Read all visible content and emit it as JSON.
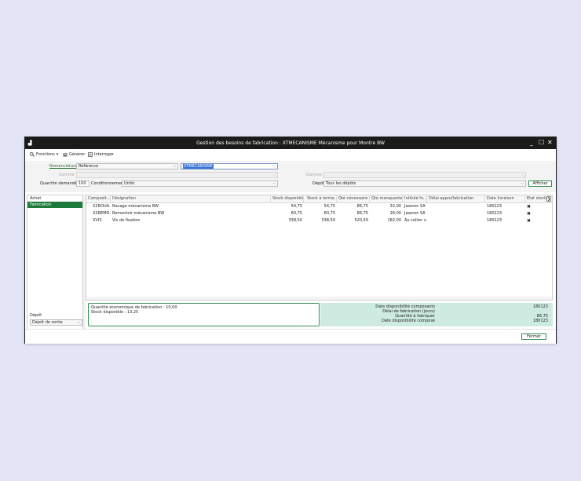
{
  "window": {
    "title": "Gestion des besoins de fabrication : XTMECANISME Mécanisme pour Montre BW",
    "minimize": "_",
    "maximize": "☐",
    "close": "✕"
  },
  "toolbar": {
    "fonctions": "Fonctions",
    "generer": "Générer",
    "interroger": "Interroger"
  },
  "form": {
    "nomenclature_label": "Nomenclature",
    "nomenclature_value": "Référence",
    "reference_value": "XTMECANISME",
    "gamme1_label": "Gamme 1",
    "gamme2_label": "Gamme 2",
    "quantite_label": "Quantité demandée",
    "quantite_value": "100",
    "conditionnement_label": "Conditionnement",
    "conditionnement_value": "Unité",
    "depot_label": "Dépôt",
    "depot_value": "Tous les dépôts",
    "afficher": "Afficher"
  },
  "sidebar": {
    "items": [
      {
        "label": "Achat"
      },
      {
        "label": "Fabrication"
      }
    ],
    "depot_label": "Dépôt",
    "depot_value": "Dépôt de sortie"
  },
  "table": {
    "columns": [
      "Composit...",
      "Désignation",
      "Stock disponible",
      "Stock à terme",
      "Qté nécessaire",
      "Qté manquante",
      "Intitulé fo...",
      "Délai appro/fabrication",
      "Date livraison",
      "Etat stock"
    ],
    "rows": [
      {
        "composant": "X2ROUA...",
        "designation": "Rouage mécanisme BW",
        "stock_dispo": "54,75",
        "stock_terme": "54,75",
        "qte_nec": "86,75",
        "qte_manq": "32,00",
        "fournisseur": "Jaseron SA",
        "delai": "",
        "date_liv": "180123",
        "etat": "✖"
      },
      {
        "composant": "X2REMO...",
        "designation": "Remontoir mécanisme BW",
        "stock_dispo": "60,75",
        "stock_terme": "60,75",
        "qte_nec": "86,75",
        "qte_manq": "26,00",
        "fournisseur": "Jaseron SA",
        "delai": "",
        "date_liv": "180123",
        "etat": "✖"
      },
      {
        "composant": "XVIS",
        "designation": "Vis de fixation",
        "stock_dispo": "338,50",
        "stock_terme": "338,50",
        "qte_nec": "520,50",
        "qte_manq": "182,00",
        "fournisseur": "Au collier s...",
        "delai": "",
        "date_liv": "180123",
        "etat": "✖"
      }
    ]
  },
  "info": {
    "line1": "Quantité économique de fabrication : 10,00",
    "line2": "Stock disponible : 13,25"
  },
  "summary": {
    "rows": [
      {
        "label": "Date disponibilité composants",
        "value": "180123"
      },
      {
        "label": "Délai de fabrication (jours)",
        "value": ""
      },
      {
        "label": "Quantité à fabriquer",
        "value": "86,75"
      },
      {
        "label": "Date disponibilité composé",
        "value": "180123"
      }
    ]
  },
  "footer": {
    "fermer": "Fermer"
  },
  "colors": {
    "accent": "#1c7a3a",
    "summary_bg": "#cdebe0",
    "error": "#d22323"
  }
}
